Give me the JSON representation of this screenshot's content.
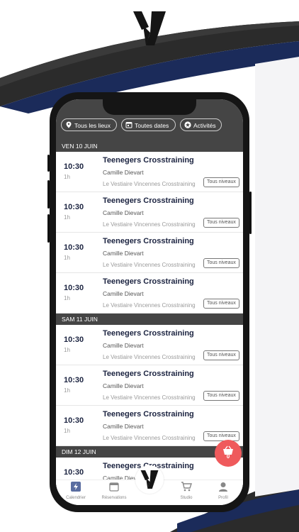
{
  "brand": {
    "dark": "#151515",
    "navy": "#1b2b5a",
    "accent": "#ef5a5c"
  },
  "filters": [
    {
      "icon": "location-pin-icon",
      "label": "Tous les lieux"
    },
    {
      "icon": "calendar-icon",
      "label": "Toutes dates"
    },
    {
      "icon": "star-icon",
      "label": "Activités"
    }
  ],
  "days": [
    {
      "label": "VEN 10 JUIN",
      "sessions": [
        {
          "time": "10:30",
          "duration": "1h",
          "title": "Teenegers Crosstraining",
          "coach": "Camille Dievart",
          "place": "Le Vestiaire Vincennes Crosstraining",
          "level": "Tous niveaux"
        },
        {
          "time": "10:30",
          "duration": "1h",
          "title": "Teenegers Crosstraining",
          "coach": "Camille Dievart",
          "place": "Le Vestiaire Vincennes Crosstraining",
          "level": "Tous niveaux"
        },
        {
          "time": "10:30",
          "duration": "1h",
          "title": "Teenegers Crosstraining",
          "coach": "Camille Dievart",
          "place": "Le Vestiaire Vincennes Crosstraining",
          "level": "Tous niveaux"
        },
        {
          "time": "10:30",
          "duration": "1h",
          "title": "Teenegers Crosstraining",
          "coach": "Camille Dievart",
          "place": "Le Vestiaire Vincennes Crosstraining",
          "level": "Tous niveaux"
        }
      ]
    },
    {
      "label": "SAM 11 JUIN",
      "sessions": [
        {
          "time": "10:30",
          "duration": "1h",
          "title": "Teenegers Crosstraining",
          "coach": "Camille Dievart",
          "place": "Le Vestiaire Vincennes Crosstraining",
          "level": "Tous niveaux"
        },
        {
          "time": "10:30",
          "duration": "1h",
          "title": "Teenegers Crosstraining",
          "coach": "Camille Dievart",
          "place": "Le Vestiaire Vincennes Crosstraining",
          "level": "Tous niveaux"
        },
        {
          "time": "10:30",
          "duration": "1h",
          "title": "Teenegers Crosstraining",
          "coach": "Camille Dievart",
          "place": "Le Vestiaire Vincennes Crosstraining",
          "level": "Tous niveaux"
        }
      ]
    },
    {
      "label": "DIM 12 JUIN",
      "sessions": [
        {
          "time": "10:30",
          "duration": "",
          "title": "Teenegers Crosstraining",
          "coach": "Camille Dievart",
          "place": "",
          "level": ""
        }
      ]
    }
  ],
  "cart": {
    "icon": "basket-icon",
    "count": "0"
  },
  "tabs": [
    {
      "icon": "bolt-icon",
      "label": "Calendrier"
    },
    {
      "icon": "calendar-icon",
      "label": "Réservations"
    },
    {
      "icon": "logo-icon",
      "label": ""
    },
    {
      "icon": "cart-icon",
      "label": "Studio"
    },
    {
      "icon": "user-icon",
      "label": "Profil"
    }
  ]
}
